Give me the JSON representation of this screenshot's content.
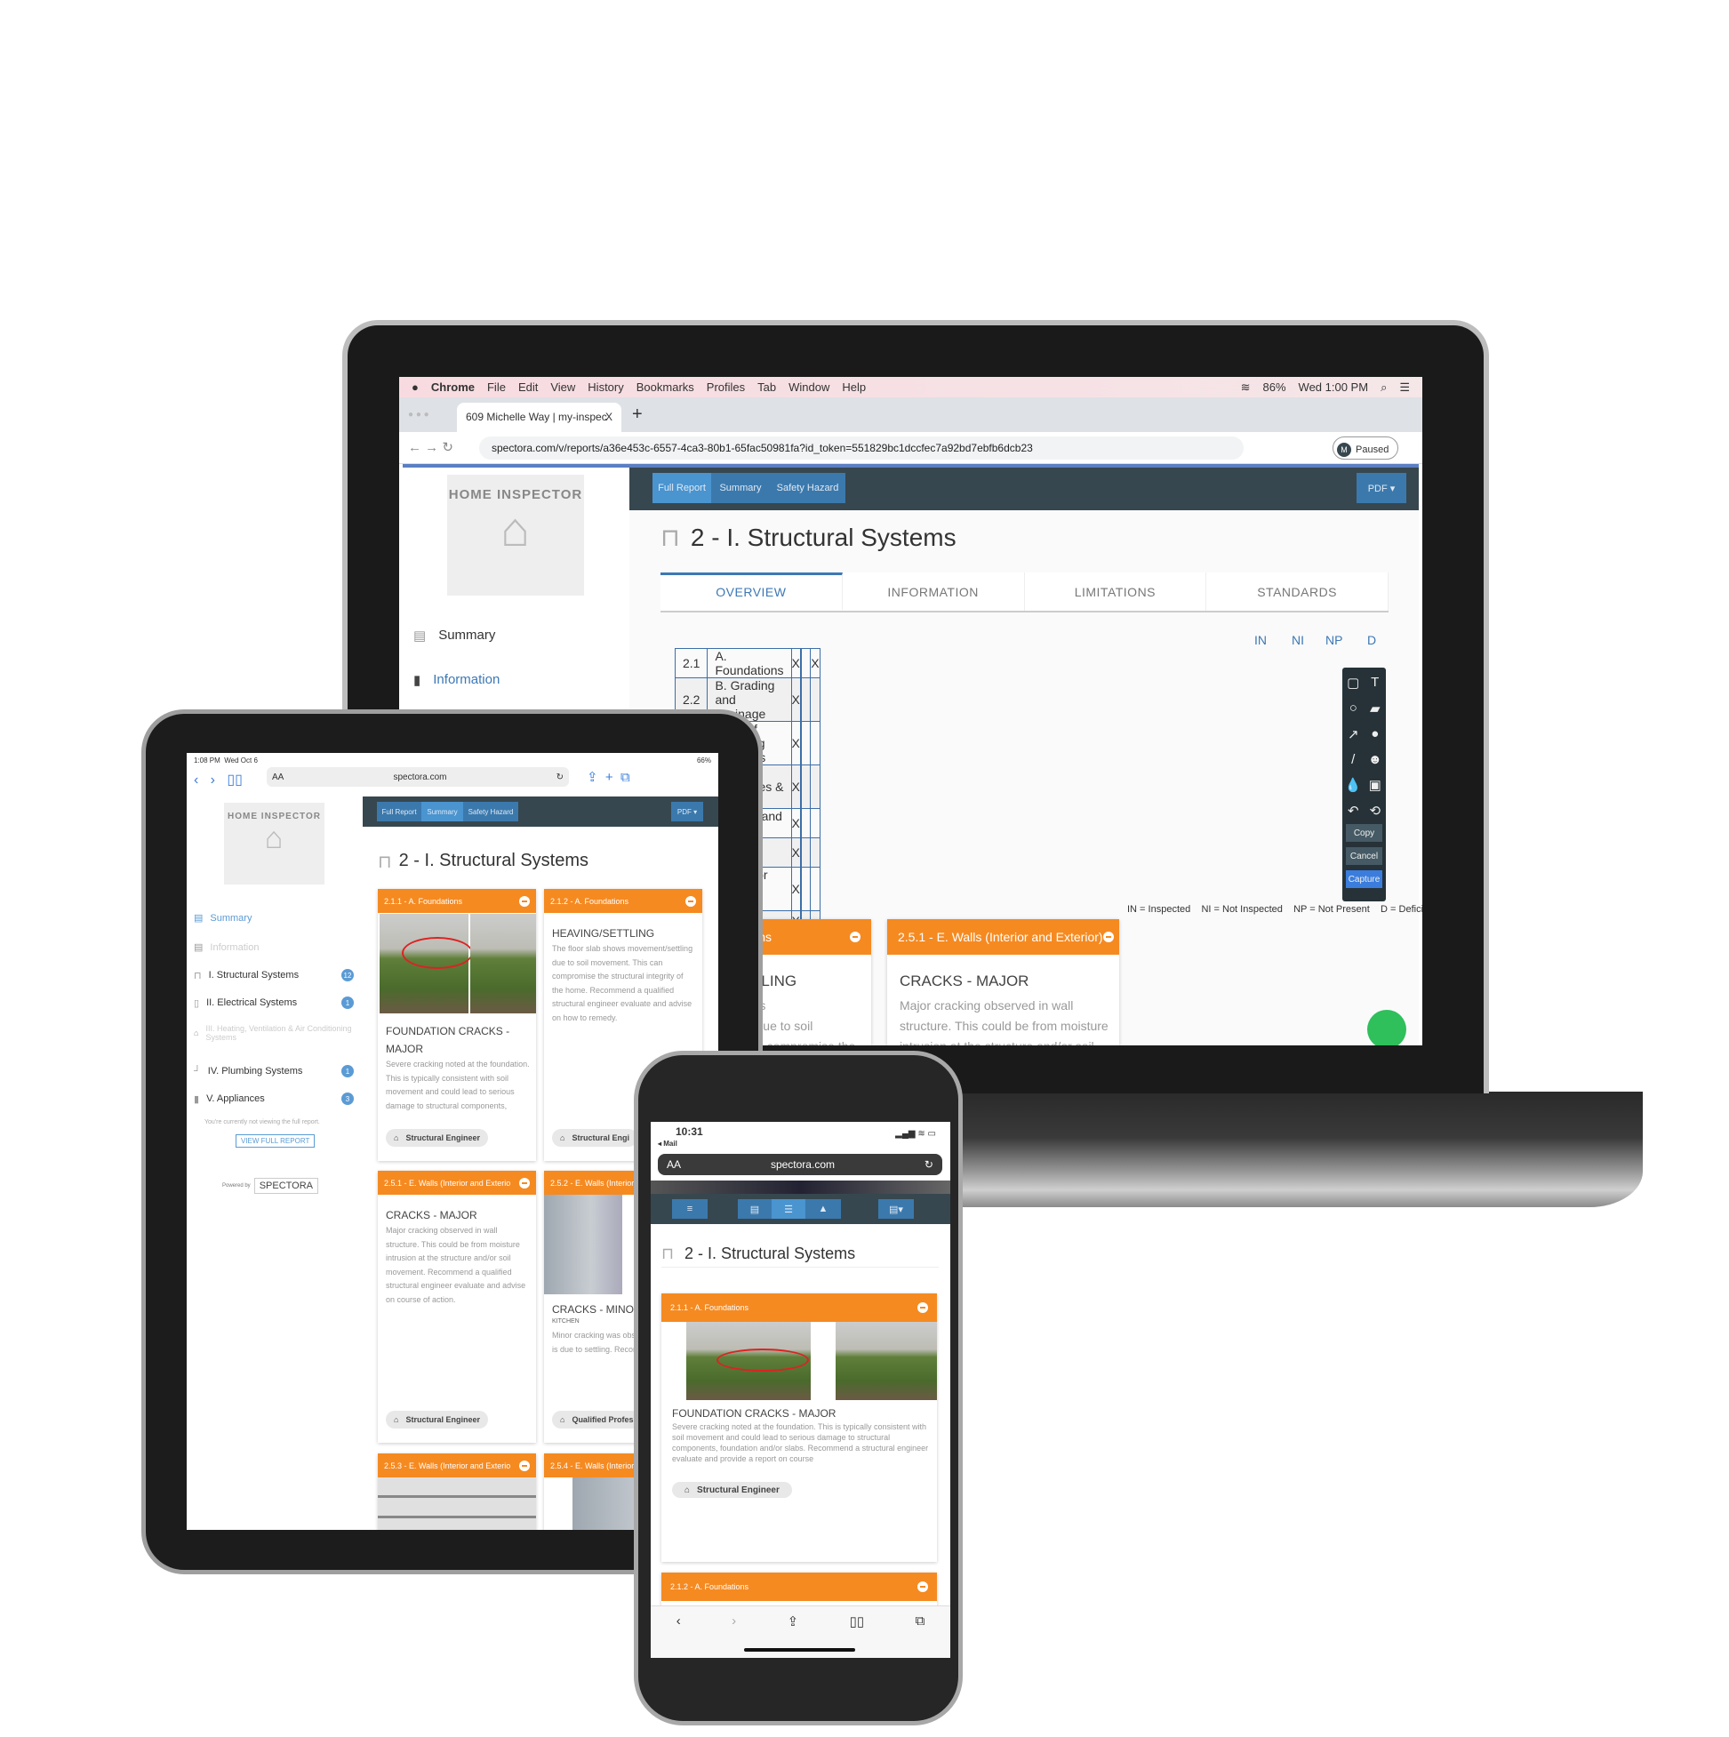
{
  "laptop": {
    "menubar": {
      "apple": "",
      "items": [
        "Chrome",
        "File",
        "Edit",
        "View",
        "History",
        "Bookmarks",
        "Profiles",
        "Tab",
        "Window",
        "Help"
      ],
      "battery": "86%",
      "clock": "Wed 1:00 PM"
    },
    "browser": {
      "tab_title": "609 Michelle Way | my-inspec",
      "tab_close": "X",
      "new_tab": "+",
      "url": "spectora.com/v/reports/a36e453c-6557-4ca3-80b1-65fac50981fa?id_token=551829bc1dccfec7a92bd7ebfb6dcb23",
      "profile_initial": "M",
      "profile_status": "Paused"
    },
    "sidebar": {
      "logo_text": "HOME INSPECTOR",
      "items": [
        {
          "label": "Summary"
        },
        {
          "label": "Information"
        }
      ]
    },
    "topnav": {
      "full_report": "Full Report",
      "summary": "Summary",
      "safety_hazard": "Safety Hazard",
      "pdf": "PDF ▾"
    },
    "title": "2 - I. Structural Systems",
    "tabs": [
      "OVERVIEW",
      "INFORMATION",
      "LIMITATIONS",
      "STANDARDS"
    ],
    "columns": [
      "IN",
      "NI",
      "NP",
      "D"
    ],
    "rows": [
      {
        "num": "2.1",
        "name": "A. Foundations",
        "in": "X",
        "ni": "",
        "np": "",
        "d": "X"
      },
      {
        "num": "2.2",
        "name": "B. Grading and Drainage",
        "in": "X",
        "ni": "",
        "np": "",
        "d": ""
      },
      {
        "num": "2.3",
        "name": "C. Roof Covering Materials",
        "in": "X",
        "ni": "",
        "np": "",
        "d": ""
      },
      {
        "num": "",
        "name": "of Structures & Attics",
        "in": "X",
        "ni": "",
        "np": "",
        "d": ""
      },
      {
        "num": "",
        "name": "(Interior and Exterior)",
        "in": "X",
        "ni": "",
        "np": "",
        "d": ""
      },
      {
        "num": "",
        "name": "gs and Floors",
        "in": "X",
        "ni": "",
        "np": "",
        "d": ""
      },
      {
        "num": "",
        "name": "s (Interior and Exterior)",
        "in": "X",
        "ni": "",
        "np": "",
        "d": ""
      },
      {
        "num": "",
        "name": "ows",
        "in": "X",
        "ni": "",
        "np": "",
        "d": ""
      },
      {
        "num": "",
        "name": "ays (Interior and Exterior)",
        "in": "",
        "ni": "",
        "np": "X",
        "d": ""
      },
      {
        "num": "",
        "name": "ces and Chimneys",
        "in": "X",
        "ni": "",
        "np": "",
        "d": ""
      },
      {
        "num": "",
        "name": "es, Balconies, Decks, and Carports",
        "in": "X",
        "ni": "",
        "np": "",
        "d": ""
      }
    ],
    "legend": "IN = Inspected    NI = Not Inspected    NP = Not Present    D = Deficiency",
    "tools": {
      "copy": "Copy",
      "cancel": "Cancel",
      "capture": "Capture",
      "icons": [
        "rectangle-icon",
        "text-icon",
        "circle-icon",
        "comment-icon",
        "arrow-icon",
        "info-icon",
        "pencil-icon",
        "emoji-icon",
        "blur-icon",
        "image-icon",
        "undo-icon",
        "reset-icon"
      ]
    },
    "cards": [
      {
        "header": "ions",
        "title": "",
        "text": ""
      },
      {
        "header": "2.1.2 - A. Foundations",
        "title": "HEAVING/SETTLING",
        "text": "The floor slab shows movement/settling due to soil movement. This can compromise the"
      },
      {
        "header": "2.5.1 - E. Walls (Interior and Exterior)",
        "title": "CRACKS - MAJOR",
        "text": "Major cracking observed in wall structure. This could be from moisture intrusion at the structure and/or soil"
      }
    ]
  },
  "tablet": {
    "status": {
      "time": "1:08 PM",
      "date": "Wed Oct 6",
      "battery": "66%"
    },
    "url": "spectora.com",
    "aa": "AA",
    "sidebar": {
      "logo_text": "HOME INSPECTOR",
      "items": [
        {
          "label": "Summary",
          "badge": ""
        },
        {
          "label": "Information",
          "badge": ""
        },
        {
          "label": "I. Structural Systems",
          "badge": "12"
        },
        {
          "label": "II. Electrical Systems",
          "badge": "1"
        },
        {
          "label": "III. Heating, Ventilation & Air Conditioning Systems",
          "badge": ""
        },
        {
          "label": "IV. Plumbing Systems",
          "badge": "1"
        },
        {
          "label": "V. Appliances",
          "badge": "3"
        }
      ],
      "notice": "You're currently not viewing the full report.",
      "view_full": "VIEW FULL REPORT",
      "powered_by": "Powered by",
      "brand": "SPECTORA"
    },
    "topnav": {
      "full_report": "Full Report",
      "summary": "Summary",
      "safety_hazard": "Safety Hazard",
      "pdf": "PDF ▾"
    },
    "title": "2 - I. Structural Systems",
    "cards": [
      {
        "header": "2.1.1 - A. Foundations",
        "title": "FOUNDATION CRACKS - MAJOR",
        "sub": "",
        "text": "Severe cracking noted at the foundation. This is typically consistent with soil movement and could lead to serious damage to structural components, foundation",
        "tag": "Structural Engineer"
      },
      {
        "header": "2.1.2 - A. Foundations",
        "title": "HEAVING/SETTLING",
        "sub": "",
        "text": "The floor slab shows movement/settling due to soil movement. This can compromise the structural integrity of the home. Recommend a qualified structural engineer evaluate and advise on how to remedy.",
        "tag": "Structural Engi"
      },
      {
        "header": "2.5.1 - E. Walls (Interior and Exterio",
        "title": "CRACKS - MAJOR",
        "sub": "",
        "text": "Major cracking observed in wall structure. This could be from moisture intrusion at the structure and/or soil movement. Recommend a qualified structural engineer evaluate and advise on course of action.",
        "tag": "Structural Engineer"
      },
      {
        "header": "2.5.2 - E. Walls (Interior",
        "title": "CRACKS - MINOR",
        "sub": "KITCHEN",
        "text": "Minor cracking was obs structure. This is due to settling. Recommend m",
        "tag": "Qualified Profes"
      },
      {
        "header": "2.5.3 - E. Walls (Interior and Exterio",
        "title": "",
        "sub": "",
        "text": "",
        "tag": ""
      },
      {
        "header": "2.5.4 - E. Walls (Interior",
        "title": "",
        "sub": "",
        "text": "",
        "tag": ""
      }
    ]
  },
  "phone": {
    "status": {
      "time": "10:31",
      "back": "◂ Mail"
    },
    "aa": "AA",
    "url": "spectora.com",
    "title": "2 - I. Structural Systems",
    "cards": [
      {
        "header": "2.1.1 - A. Foundations",
        "title": "FOUNDATION CRACKS - MAJOR",
        "text": "Severe cracking noted at the foundation. This is typically consistent with soil movement and could lead to serious damage to structural components, foundation and/or slabs. Recommend a structural engineer evaluate and provide a report on course",
        "tag": "Structural Engineer"
      },
      {
        "header": "2.1.2 - A. Foundations"
      }
    ]
  },
  "colors": {
    "accent_orange": "#f58a21",
    "nav_dark": "#37474f",
    "nav_blue": "#3b79ad",
    "link_blue": "#3c78b5"
  }
}
